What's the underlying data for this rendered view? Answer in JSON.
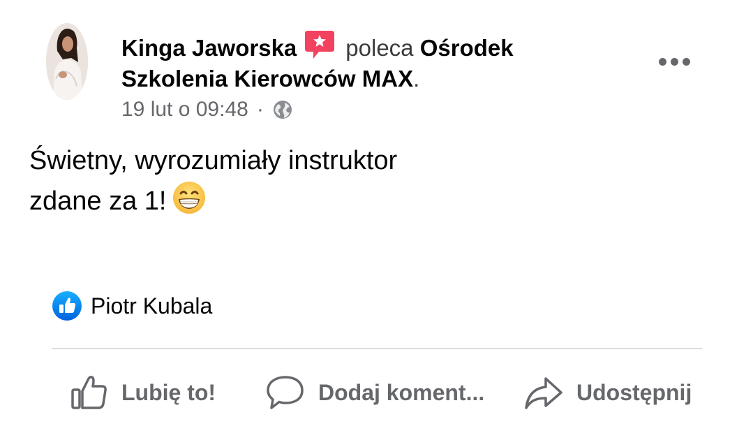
{
  "post": {
    "author": "Kinga Jaworska",
    "action_text": "poleca",
    "target_page": "Ośrodek Szkolenia Kierowców MAX",
    "punctuation": ".",
    "timestamp": "19 lut o 09:48",
    "separator": "·",
    "privacy_icon": "globe-icon",
    "body_lines": [
      "Świetny, wyrozumiały instruktor",
      "zdane za 1!"
    ],
    "emoji": "grinning-face-with-smiling-eyes"
  },
  "reactions": {
    "icon": "like-icon",
    "names": "Piotr Kubala"
  },
  "actions": {
    "like_label": "Lubię to!",
    "comment_label": "Dodaj koment...",
    "share_label": "Udostępnij"
  },
  "colors": {
    "recommend_icon": "#f3425f",
    "like_blue": "#1877f2",
    "secondary_text": "#65676b",
    "divider": "#dadde1"
  }
}
